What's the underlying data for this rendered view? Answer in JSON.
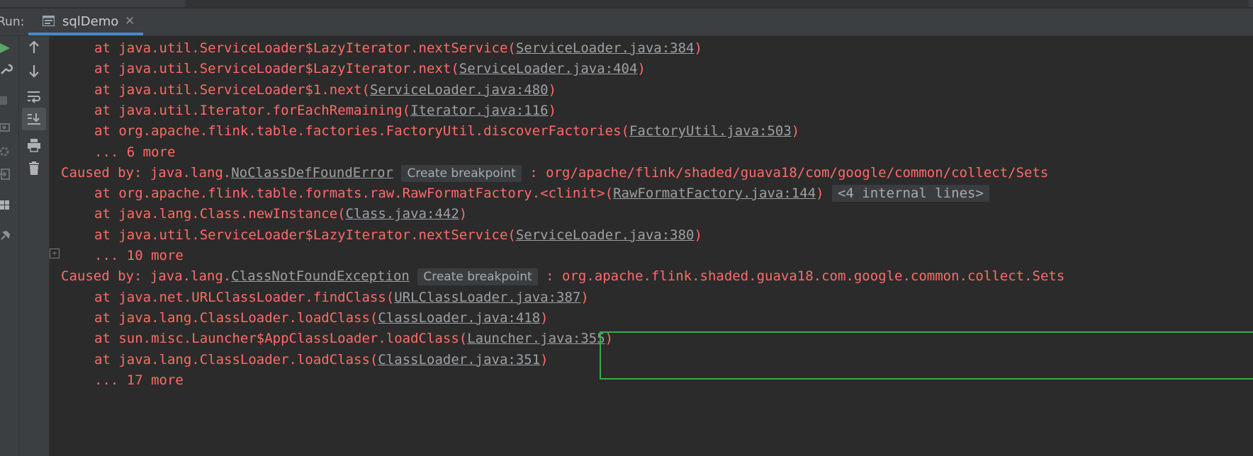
{
  "run_header": {
    "label": "Run:",
    "tab_label": "sqlDemo",
    "close_glyph": "✕"
  },
  "left_strip_icons": [
    "run-icon",
    "wrench-icon",
    "stop-icon",
    "camera-icon",
    "settings-icon",
    "login-icon",
    "layout-icon",
    "pin-icon"
  ],
  "toolbar_icons": [
    "arrow-up-icon",
    "arrow-down-icon",
    "soft-wrap-icon",
    "scroll-to-end-icon",
    "print-icon",
    "trash-icon"
  ],
  "console": {
    "lines": [
      {
        "type": "frame",
        "prefix": "at java.util.ServiceLoader$LazyIterator.nextService(",
        "link": "ServiceLoader.java:384",
        "suffix": ")"
      },
      {
        "type": "frame",
        "prefix": "at java.util.ServiceLoader$LazyIterator.next(",
        "link": "ServiceLoader.java:404",
        "suffix": ")"
      },
      {
        "type": "frame",
        "prefix": "at java.util.ServiceLoader$1.next(",
        "link": "ServiceLoader.java:480",
        "suffix": ")"
      },
      {
        "type": "frame",
        "prefix": "at java.util.Iterator.forEachRemaining(",
        "link": "Iterator.java:116",
        "suffix": ")"
      },
      {
        "type": "frame",
        "prefix": "at org.apache.flink.table.factories.FactoryUtil.discoverFactories(",
        "link": "FactoryUtil.java:503",
        "suffix": ")"
      },
      {
        "type": "more",
        "text": "... 6 more"
      },
      {
        "type": "caused",
        "prefix": "Caused by: java.lang.",
        "link": "NoClassDefFoundError",
        "hint": "Create breakpoint",
        "suffix": ": org/apache/flink/shaded/guava18/com/google/common/collect/Sets"
      },
      {
        "type": "frame",
        "prefix": "at org.apache.flink.table.formats.raw.RawFormatFactory.<clinit>(",
        "link": "RawFormatFactory.java:144",
        "suffix": ")",
        "fold": "<4 internal lines>"
      },
      {
        "type": "frame",
        "prefix": "at java.lang.Class.newInstance(",
        "link": "Class.java:442",
        "suffix": ")"
      },
      {
        "type": "frame",
        "prefix": "at java.util.ServiceLoader$LazyIterator.nextService(",
        "link": "ServiceLoader.java:380",
        "suffix": ")"
      },
      {
        "type": "more",
        "text": "... 10 more"
      },
      {
        "type": "caused",
        "prefix": "Caused by: java.lang.",
        "link": "ClassNotFoundException",
        "hint": "Create breakpoint",
        "suffix": ": org.apache.flink.shaded.guava18.com.google.common.collect.Sets"
      },
      {
        "type": "frame",
        "prefix": "at java.net.URLClassLoader.findClass(",
        "link": "URLClassLoader.java:387",
        "suffix": ")"
      },
      {
        "type": "frame",
        "prefix": "at java.lang.ClassLoader.loadClass(",
        "link": "ClassLoader.java:418",
        "suffix": ")"
      },
      {
        "type": "frame",
        "prefix": "at sun.misc.Launcher$AppClassLoader.loadClass(",
        "link": "Launcher.java:355",
        "suffix": ")"
      },
      {
        "type": "frame",
        "prefix": "at java.lang.ClassLoader.loadClass(",
        "link": "ClassLoader.java:351",
        "suffix": ")"
      },
      {
        "type": "more",
        "text": "... 17 more"
      }
    ]
  },
  "colors": {
    "error_text": "#ff6b68",
    "link": "#9da0a4",
    "highlight_box": "#2fb04a",
    "tab_underline": "#4a88c7",
    "run_icon": "#59a869"
  }
}
